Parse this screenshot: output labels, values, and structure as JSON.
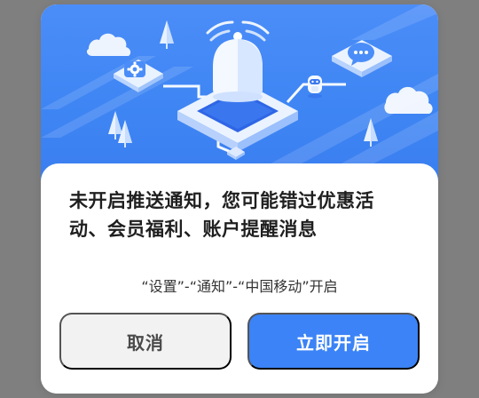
{
  "dialog": {
    "title": "未开启推送通知，您可能错过优惠活动、会员福利、账户提醒消息",
    "instruction": "“设置”-“通知”-“中国移动”开启",
    "cancel_label": "取消",
    "confirm_label": "立即开启"
  },
  "colors": {
    "hero_blue": "#4b8df8",
    "primary_button": "#3b83f6",
    "secondary_button": "#f2f2f2",
    "overlay": "#7f7f7f"
  },
  "icons": {
    "bell": "bell-icon",
    "gear": "gear-icon",
    "chat": "chat-bubble-icon",
    "robot": "robot-icon",
    "cloud": "cloud-icon",
    "tree": "tree-icon"
  }
}
